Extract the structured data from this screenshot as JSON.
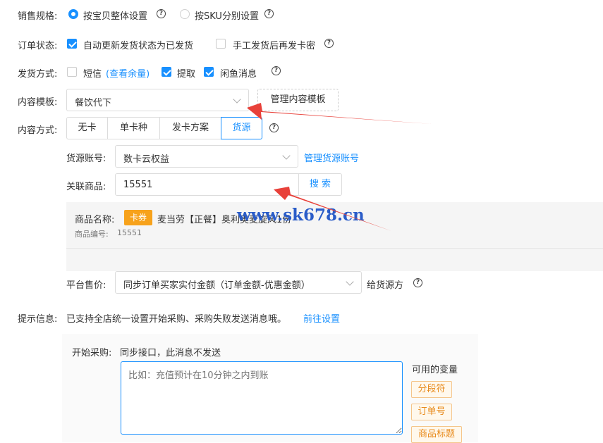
{
  "sales_spec": {
    "label": "销售规格:",
    "opt1": "按宝贝整体设置",
    "opt2": "按SKU分别设置"
  },
  "order_status": {
    "label": "订单状态:",
    "opt1": "自动更新发货状态为已发货",
    "opt2": "手工发货后再发卡密"
  },
  "delivery": {
    "label": "发货方式:",
    "sms": "短信",
    "sms_link": "(查看余量)",
    "pickup": "提取",
    "xianyu": "闲鱼消息"
  },
  "template": {
    "label": "内容模板:",
    "value": "餐饮代下",
    "manage": "管理内容模板"
  },
  "content_mode": {
    "label": "内容方式:",
    "tabs": [
      "无卡",
      "单卡种",
      "发卡方案",
      "货源"
    ],
    "active": 3
  },
  "source_account": {
    "label": "货源账号:",
    "value": "数卡云权益",
    "manage": "管理货源账号"
  },
  "linked_product": {
    "label": "关联商品:",
    "value": "15551",
    "search": "搜 索"
  },
  "product": {
    "name_label": "商品名称:",
    "badge": "卡券",
    "name": "麦当劳【正餐】奥利奥麦旋风1份",
    "no_label": "商品编号:",
    "no": "15551"
  },
  "watermark": "www.sk678.cn",
  "price": {
    "label": "平台售价:",
    "value": "同步订单买家实付金额（订单金额-优惠金额）",
    "suffix": "给货源方"
  },
  "tips": {
    "label": "提示信息:",
    "text": "已支持全店统一设置开始采购、采购失败发送消息哦。",
    "link": "前往设置"
  },
  "purchase": {
    "label": "开始采购:",
    "note": "同步接口，此消息不发送",
    "placeholder": "比如：充值预计在10分钟之内到账"
  },
  "variables": {
    "label": "可用的变量",
    "items": [
      "分段符",
      "订单号",
      "商品标题"
    ]
  },
  "colors": {
    "accent": "#1890ff",
    "arrow": "#e8413a",
    "tag": "#e88a1a"
  }
}
